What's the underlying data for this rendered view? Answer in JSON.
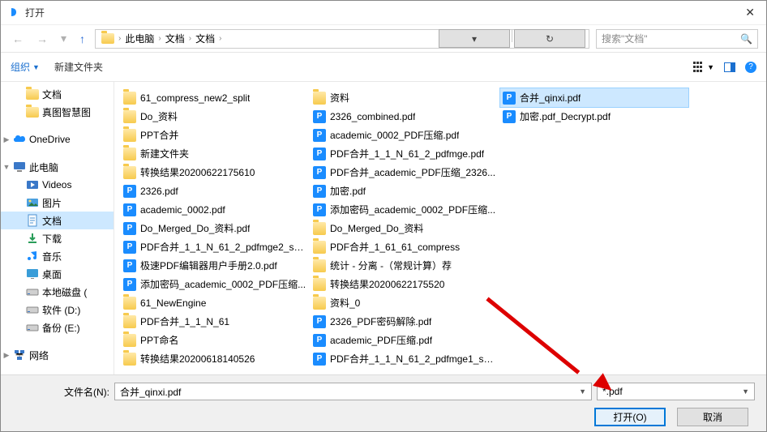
{
  "title": "打开",
  "breadcrumbs": [
    "此电脑",
    "文档",
    "文档"
  ],
  "search_placeholder": "搜索\"文档\"",
  "toolbar": {
    "organize": "组织",
    "new_folder": "新建文件夹"
  },
  "tree": [
    {
      "label": "文档",
      "icon": "folder",
      "lvl": 2,
      "exp": ""
    },
    {
      "label": "真图智慧图",
      "icon": "folder",
      "lvl": 2,
      "exp": ""
    },
    {
      "spacer": true
    },
    {
      "label": "OneDrive",
      "icon": "onedrive",
      "lvl": 1,
      "exp": "▶"
    },
    {
      "spacer": true
    },
    {
      "label": "此电脑",
      "icon": "thispc",
      "lvl": 1,
      "exp": "▼"
    },
    {
      "label": "Videos",
      "icon": "videos",
      "lvl": 2,
      "exp": ""
    },
    {
      "label": "图片",
      "icon": "pictures",
      "lvl": 2,
      "exp": ""
    },
    {
      "label": "文档",
      "icon": "docs",
      "lvl": 2,
      "exp": "",
      "sel": true
    },
    {
      "label": "下载",
      "icon": "downloads",
      "lvl": 2,
      "exp": ""
    },
    {
      "label": "音乐",
      "icon": "music",
      "lvl": 2,
      "exp": ""
    },
    {
      "label": "桌面",
      "icon": "desktop",
      "lvl": 2,
      "exp": ""
    },
    {
      "label": "本地磁盘 (",
      "icon": "disk",
      "lvl": 2,
      "exp": ""
    },
    {
      "label": "软件 (D:)",
      "icon": "disk",
      "lvl": 2,
      "exp": ""
    },
    {
      "label": "备份 (E:)",
      "icon": "disk",
      "lvl": 2,
      "exp": ""
    },
    {
      "spacer": true
    },
    {
      "label": "网络",
      "icon": "network",
      "lvl": 1,
      "exp": "▶"
    }
  ],
  "files": [
    {
      "name": "61_compress_new2_split",
      "type": "folder"
    },
    {
      "name": "Do_资料",
      "type": "folder"
    },
    {
      "name": "PPT合并",
      "type": "folder"
    },
    {
      "name": "新建文件夹",
      "type": "folder"
    },
    {
      "name": "转换结果20200622175610",
      "type": "folder"
    },
    {
      "name": "2326.pdf",
      "type": "pdf"
    },
    {
      "name": "academic_0002.pdf",
      "type": "pdf"
    },
    {
      "name": "Do_Merged_Do_资料.pdf",
      "type": "pdf"
    },
    {
      "name": "PDF合并_1_1_N_61_2_pdfmge2_sp...",
      "type": "pdf"
    },
    {
      "name": "极速PDF编辑器用户手册2.0.pdf",
      "type": "pdf"
    },
    {
      "name": "添加密码_academic_0002_PDF压缩...",
      "type": "pdf"
    },
    {
      "name": "61_NewEngine",
      "type": "folder"
    },
    {
      "name": "PDF合并_1_1_N_61",
      "type": "folder"
    },
    {
      "name": "PPT命名",
      "type": "folder"
    },
    {
      "name": "转换结果20200618140526",
      "type": "folder"
    },
    {
      "name": "资料",
      "type": "folder"
    },
    {
      "name": "2326_combined.pdf",
      "type": "pdf"
    },
    {
      "name": "academic_0002_PDF压缩.pdf",
      "type": "pdf"
    },
    {
      "name": "PDF合并_1_1_N_61_2_pdfmge.pdf",
      "type": "pdf"
    },
    {
      "name": "PDF合并_academic_PDF压缩_2326...",
      "type": "pdf"
    },
    {
      "name": "加密.pdf",
      "type": "pdf"
    },
    {
      "name": "添加密码_academic_0002_PDF压缩...",
      "type": "pdf"
    },
    {
      "name": "Do_Merged_Do_资料",
      "type": "folder"
    },
    {
      "name": "PDF合并_1_61_61_compress",
      "type": "folder"
    },
    {
      "name": "统计 - 分离 -（常规计算）荐",
      "type": "folder"
    },
    {
      "name": "转换结果20200622175520",
      "type": "folder"
    },
    {
      "name": "资料_0",
      "type": "folder"
    },
    {
      "name": "2326_PDF密码解除.pdf",
      "type": "pdf"
    },
    {
      "name": "academic_PDF压缩.pdf",
      "type": "pdf"
    },
    {
      "name": "PDF合并_1_1_N_61_2_pdfmge1_sp...",
      "type": "pdf"
    },
    {
      "name": "合并_qinxi.pdf",
      "type": "pdf",
      "sel": true
    },
    {
      "name": "加密.pdf_Decrypt.pdf",
      "type": "pdf"
    }
  ],
  "filename_label": "文件名(N):",
  "filename_value": "合并_qinxi.pdf",
  "filetype_value": "*.pdf",
  "open_btn": "打开(O)",
  "cancel_btn": "取消"
}
